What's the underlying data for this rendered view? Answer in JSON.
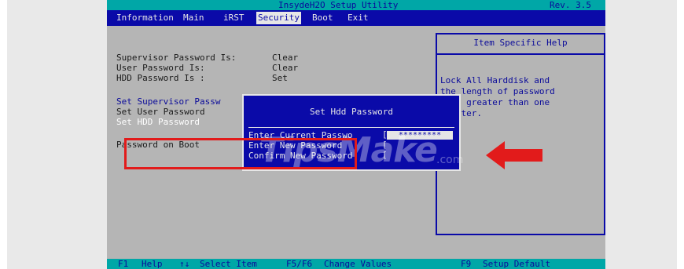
{
  "title": "InsydeH2O Setup Utility",
  "revision": "Rev. 3.5",
  "menu": [
    "Information",
    "Main",
    "iRST",
    "Security",
    "Boot",
    "Exit"
  ],
  "active_menu": "Security",
  "status": {
    "supervisor_label": "Supervisor Password Is:",
    "supervisor_value": "Clear",
    "user_label": "User Password Is:",
    "user_value": "Clear",
    "hdd_label": "HDD Password Is :",
    "hdd_value": "Set"
  },
  "options": {
    "set_supervisor": "Set Supervisor Passw",
    "set_user": "Set User Password",
    "set_hdd": "Set HDD Password",
    "password_on_boot": "Password on Boot"
  },
  "help": {
    "title": "Item Specific Help",
    "lines": [
      "Lock All Harddisk and",
      "the length of password",
      "  be greater than one",
      "  acter."
    ]
  },
  "dialog": {
    "title": "Set Hdd Password",
    "current_label": "Enter Current Passwo",
    "current_value": "*********",
    "new_label": "Enter New Password",
    "confirm_label": "Confirm New Password"
  },
  "watermark": {
    "main": "TipsMake",
    "suffix": ".com"
  },
  "bottom": [
    {
      "key": "F1",
      "desc": "Help"
    },
    {
      "key": "↑↓",
      "desc": "Select Item"
    },
    {
      "key": "F5/F6",
      "desc": "Change Values"
    },
    {
      "key": "F9",
      "desc": "Setup Default"
    }
  ],
  "colors": {
    "bios_blue": "#0a0aa8",
    "bios_cyan": "#00a7a7",
    "bios_gray": "#b5b5b5",
    "annotation_red": "#e21b1b"
  }
}
